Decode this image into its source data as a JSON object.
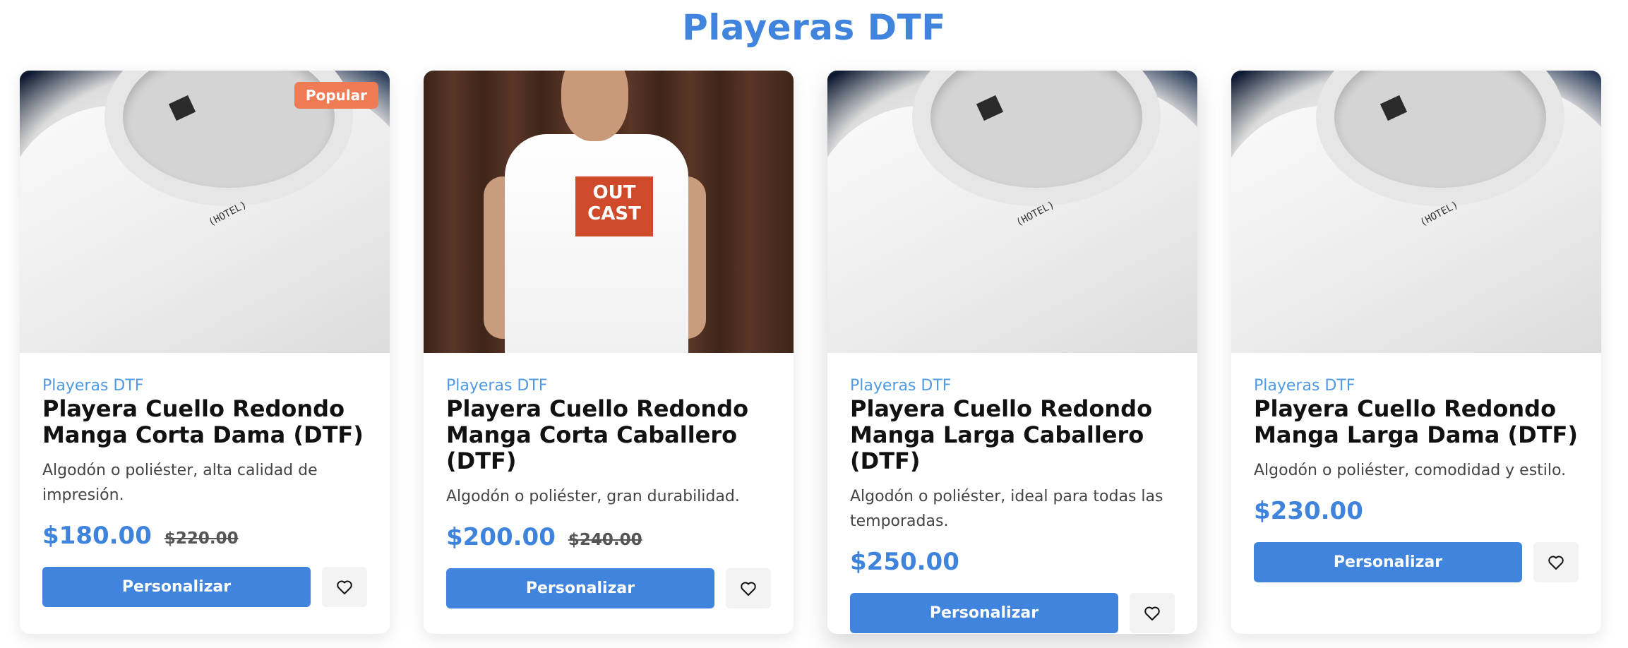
{
  "page": {
    "title": "Playeras DTF"
  },
  "products": [
    {
      "badge": "Popular",
      "category": "Playeras DTF",
      "name": "Playera Cuello Redondo Manga Corta Dama (DTF)",
      "description": "Algodón o poliéster, alta calidad de impresión.",
      "price": "$180.00",
      "old_price": "$220.00",
      "button": "Personalizar",
      "image_text": "(HOTEL)"
    },
    {
      "category": "Playeras DTF",
      "name": "Playera Cuello Redondo Manga Corta Caballero (DTF)",
      "description": "Algodón o poliéster, gran durabilidad.",
      "price": "$200.00",
      "old_price": "$240.00",
      "button": "Personalizar",
      "image_text": "OUT CAST"
    },
    {
      "category": "Playeras DTF",
      "name": "Playera Cuello Redondo Manga Larga Caballero (DTF)",
      "description": "Algodón o poliéster, ideal para todas las temporadas.",
      "price": "$250.00",
      "button": "Personalizar",
      "image_text": "(HOTEL)"
    },
    {
      "category": "Playeras DTF",
      "name": "Playera Cuello Redondo Manga Larga Dama (DTF)",
      "description": "Algodón o poliéster, comodidad y estilo.",
      "price": "$230.00",
      "button": "Personalizar",
      "image_text": "(HOTEL)"
    }
  ],
  "icons": {
    "favorite": "heart-outline-icon"
  },
  "colors": {
    "accent": "#4184dd",
    "badge": "#ef7b54",
    "category": "#4e9ae6"
  }
}
